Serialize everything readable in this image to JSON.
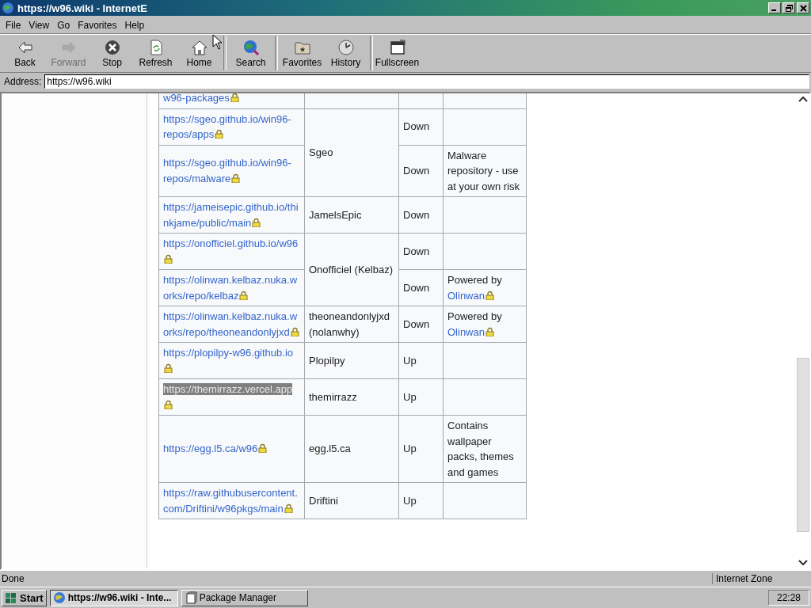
{
  "window": {
    "title": "https://w96.wiki - InternetE"
  },
  "menu": [
    "File",
    "View",
    "Go",
    "Favorites",
    "Help"
  ],
  "toolbar": {
    "groups": [
      {
        "buttons": [
          {
            "label": "Back",
            "disabled": false
          },
          {
            "label": "Forward",
            "disabled": true
          },
          {
            "label": "Stop",
            "disabled": false
          },
          {
            "label": "Refresh",
            "disabled": false
          },
          {
            "label": "Home",
            "disabled": false
          }
        ]
      },
      {
        "buttons": [
          {
            "label": "Search",
            "disabled": false
          }
        ]
      },
      {
        "buttons": [
          {
            "label": "Favorites",
            "disabled": false
          },
          {
            "label": "History",
            "disabled": false
          }
        ]
      },
      {
        "buttons": [
          {
            "label": "Fullscreen",
            "disabled": false
          }
        ]
      }
    ]
  },
  "address": {
    "label": "Address:",
    "value": "https://w96.wiki"
  },
  "table": {
    "groups": [
      {
        "repos": [
          {
            "url": "w96-packages",
            "selected": false
          }
        ]
      },
      {
        "owner": "Sgeo",
        "repos": [
          {
            "url": "https://sgeo.github.io/win96-repos/apps",
            "selected": false,
            "status": "Down"
          },
          {
            "url": "https://sgeo.github.io/win96-repos/malware",
            "selected": false,
            "status": "Down",
            "notes": "Malware repository - use at your own risk"
          }
        ]
      },
      {
        "owner": "JamelsEpic",
        "repos": [
          {
            "url": "https://jameisepic.github.io/thinkjame/public/main",
            "selected": false,
            "status": "Down"
          }
        ]
      },
      {
        "owner": "Onofficiel (Kelbaz)",
        "repos": [
          {
            "url": "https://onofficiel.github.io/w96",
            "selected": false,
            "status": "Down"
          },
          {
            "url": "https://olinwan.kelbaz.nuka.works/repo/kelbaz",
            "selected": false,
            "status": "Down",
            "notes": "Powered by",
            "notes_link": "Olinwan"
          }
        ]
      },
      {
        "owner": "theoneandonlyjxd (nolanwhy)",
        "repos": [
          {
            "url": "https://olinwan.kelbaz.nuka.works/repo/theoneandonlyjxd",
            "selected": false,
            "status": "Down",
            "notes": "Powered by",
            "notes_link": "Olinwan"
          }
        ]
      },
      {
        "owner": "Plopilpy",
        "repos": [
          {
            "url": "https://plopilpy-w96.github.io",
            "selected": false,
            "status": "Up"
          }
        ]
      },
      {
        "owner": "themirrazz",
        "repos": [
          {
            "url": "https://themirrazz.vercel.app",
            "selected": true,
            "status": "Up"
          }
        ]
      },
      {
        "owner": "egg.l5.ca",
        "repos": [
          {
            "url": "https://egg.l5.ca/w96",
            "selected": false,
            "status": "Up",
            "notes": "Contains wallpaper packs, themes and games"
          }
        ]
      },
      {
        "owner": "Driftini",
        "repos": [
          {
            "url": "https://raw.githubusercontent.com/Driftini/w96pkgs/main",
            "selected": false,
            "status": "Up"
          }
        ]
      }
    ]
  },
  "status_bar": {
    "text": "Done",
    "zone": "Internet Zone"
  },
  "taskbar": {
    "start": "Start",
    "tasks": [
      {
        "label": "https://w96.wiki - Inte...",
        "selected": true
      },
      {
        "label": "Package Manager",
        "selected": false
      }
    ],
    "clock": "22:28"
  }
}
